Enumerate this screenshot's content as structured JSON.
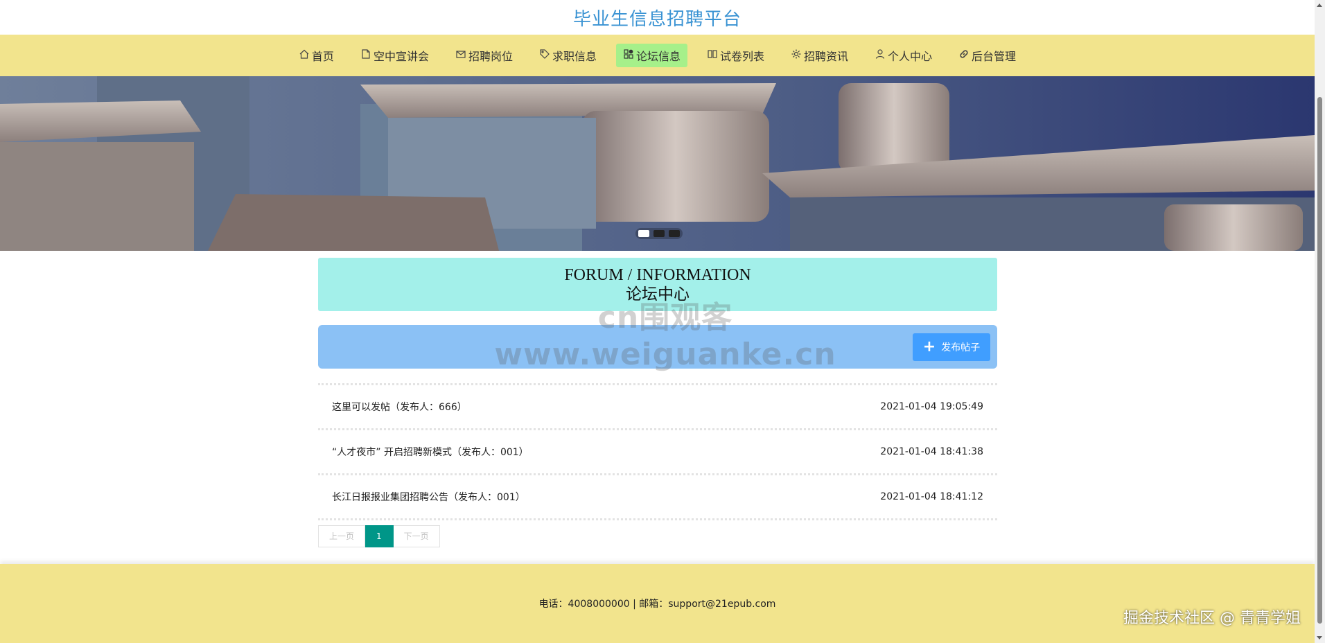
{
  "site": {
    "title": "毕业生信息招聘平台"
  },
  "nav": {
    "items": [
      {
        "label": "首页",
        "icon": "home-icon"
      },
      {
        "label": "空中宣讲会",
        "icon": "document-icon"
      },
      {
        "label": "招聘岗位",
        "icon": "mail-icon"
      },
      {
        "label": "求职信息",
        "icon": "tag-icon"
      },
      {
        "label": "论坛信息",
        "icon": "apps-icon",
        "active": true
      },
      {
        "label": "试卷列表",
        "icon": "read-icon"
      },
      {
        "label": "招聘资讯",
        "icon": "gear-icon"
      },
      {
        "label": "个人中心",
        "icon": "user-icon"
      },
      {
        "label": "后台管理",
        "icon": "link-icon"
      }
    ],
    "active_color": "#a6f08a"
  },
  "banner": {
    "slides": 3,
    "active_slide": 1
  },
  "forum": {
    "title_en": "FORUM / INFORMATION",
    "title_cn": "论坛中心"
  },
  "watermark": "cn围观客www.weiguanke.cn",
  "toolbar": {
    "post_button": "发布帖子"
  },
  "posts": [
    {
      "title": "这里可以发帖（发布人：666）",
      "time": "2021-01-04 19:05:49"
    },
    {
      "title": "“人才夜市” 开启招聘新模式（发布人：001）",
      "time": "2021-01-04 18:41:38"
    },
    {
      "title": "长江日报报业集团招聘公告（发布人：001）",
      "time": "2021-01-04 18:41:12"
    }
  ],
  "pagination": {
    "prev": "上一页",
    "current": "1",
    "next": "下一页"
  },
  "footer": {
    "contact": "电话：4008000000 | 邮箱：support@21epub.com"
  },
  "corner_mark": "掘金技术社区 @ 青青学姐",
  "colors": {
    "title": "#3a93d3",
    "nav_bg": "#f2e48d",
    "forum_head_bg": "#a3f0ea",
    "toolbar_bg": "#8bc1f5",
    "button_bg": "#409eff",
    "pager_active": "#009688"
  }
}
